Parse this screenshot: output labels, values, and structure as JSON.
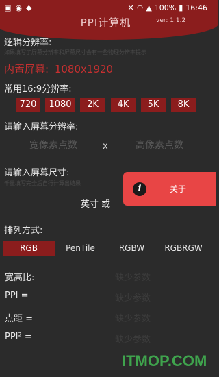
{
  "status_bar": {
    "left_icons": [
      "image-icon",
      "weibo-icon",
      "app-icon"
    ],
    "right_icons": [
      "mute-icon",
      "wifi-icon",
      "signal-icon"
    ],
    "battery": "100%",
    "time": "16:46"
  },
  "header": {
    "title": "PPI计算机",
    "version": "ver: 1.1.2"
  },
  "logical": {
    "label": "逻辑分辨率:",
    "hint": "如果填写了屏幕分辨率和屏幕尺寸会有一些物理分辨率提示",
    "builtin_screen_label": "内置屏幕:",
    "builtin_screen_value": "1080x1920"
  },
  "common_res": {
    "label": "常用16:9分辨率:",
    "buttons": [
      "720",
      "1080",
      "2K",
      "4K",
      "5K",
      "8K"
    ]
  },
  "screen_res": {
    "label": "请输入屏幕分辨率:",
    "width_placeholder": "宽像素点数",
    "separator": "x",
    "height_placeholder": "高像素点数"
  },
  "screen_size": {
    "label": "请输入屏幕尺寸:",
    "hint": "千量填写完全后自行计算出结果",
    "unit_or": "英寸 或"
  },
  "arrangement": {
    "label": "排列方式:",
    "options": [
      "RGB",
      "PenTile",
      "RGBW",
      "RGBRGW"
    ],
    "selected": "RGB"
  },
  "results": [
    {
      "label": "宽高比:",
      "value": "缺少参数"
    },
    {
      "label": "PPI =",
      "value": "缺少参数"
    },
    {
      "label": "点距 =",
      "value": "缺少参数"
    },
    {
      "label": "PPI² =",
      "value": "缺少参数"
    }
  ],
  "about_popup": {
    "label": "关于",
    "icon": "info-icon"
  },
  "watermark": "ITMOP.COM",
  "colors": {
    "accent": "#8b1d1d",
    "highlight": "#c73030",
    "popup": "#e84545",
    "watermark": "#3fa34d"
  }
}
